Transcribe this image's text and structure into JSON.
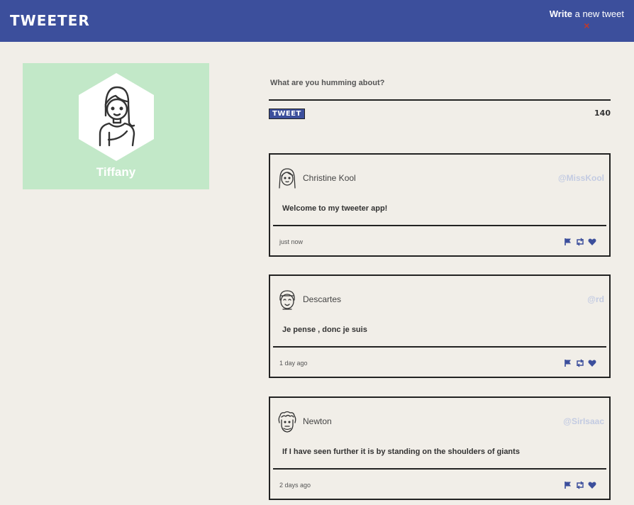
{
  "header": {
    "brand": "TWEETER",
    "compose_toggle_bold": "Write",
    "compose_toggle_rest": " a new tweet",
    "close_label": "×"
  },
  "profile": {
    "name": "Tiffany",
    "avatar_icon": "woman-avatar-icon",
    "background_color": "#c2e8c8"
  },
  "composer": {
    "prompt": "What are you humming about?",
    "button_label": "TWEET",
    "char_count": "140"
  },
  "tweets": [
    {
      "name": "Christine Kool",
      "handle": "@MissKool",
      "body": "Welcome to my tweeter app!",
      "time": "just now",
      "avatar_icon": "woman-avatar-icon"
    },
    {
      "name": "Descartes",
      "handle": "@rd",
      "body": "Je pense , donc je suis",
      "time": "1 day ago",
      "avatar_icon": "smiling-man-avatar-icon"
    },
    {
      "name": "Newton",
      "handle": "@SirIsaac",
      "body": "If I have seen further it is by standing on the shoulders of giants",
      "time": "2 days ago",
      "avatar_icon": "curly-haired-man-avatar-icon"
    }
  ],
  "action_icons": [
    "flag-icon",
    "retweet-icon",
    "heart-icon"
  ],
  "colors": {
    "accent": "#3c4f9c",
    "background": "#f1eee8",
    "handle": "#c3cbe2",
    "close": "#c0392b"
  }
}
